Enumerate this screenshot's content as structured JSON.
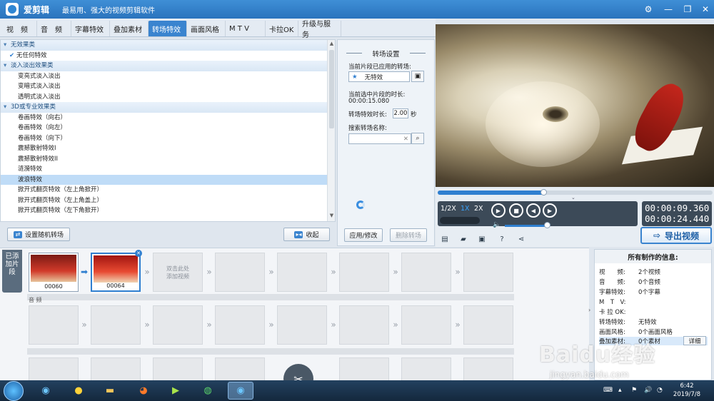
{
  "app": {
    "name": "爱剪辑",
    "slogan": "最易用、强大的视频剪辑软件",
    "window_controls": [
      "⚙",
      "—",
      "❐",
      "✕"
    ]
  },
  "tabs": [
    {
      "label": "视　频",
      "active": false
    },
    {
      "label": "音　频",
      "active": false
    },
    {
      "label": "字幕特效",
      "active": false
    },
    {
      "label": "叠加素材",
      "active": false
    },
    {
      "label": "转场特效",
      "active": true
    },
    {
      "label": "画面风格",
      "active": false
    },
    {
      "label": "M T V",
      "active": false
    },
    {
      "label": "卡拉OK",
      "active": false
    },
    {
      "label": "升级与服务",
      "active": false
    }
  ],
  "effects": {
    "rows": [
      {
        "type": "cat",
        "label": "无效果类"
      },
      {
        "type": "item",
        "label": "无任何特效",
        "checked": true
      },
      {
        "type": "cat",
        "label": "淡入淡出效果类"
      },
      {
        "type": "item",
        "label": "变亮式淡入淡出"
      },
      {
        "type": "item",
        "label": "变暗式淡入淡出"
      },
      {
        "type": "item",
        "label": "透明式淡入淡出"
      },
      {
        "type": "cat",
        "label": "3D或专业效果类"
      },
      {
        "type": "item",
        "label": "卷画特效（向右）"
      },
      {
        "type": "item",
        "label": "卷画特效（向左）"
      },
      {
        "type": "item",
        "label": "卷画特效（向下）"
      },
      {
        "type": "item",
        "label": "震撼散射特效I"
      },
      {
        "type": "item",
        "label": "震撼散射特效II"
      },
      {
        "type": "item",
        "label": "涟漪特效"
      },
      {
        "type": "item",
        "label": "波浪特效",
        "selected": true
      },
      {
        "type": "item",
        "label": "掀开式翻页特效（左上角掀开）"
      },
      {
        "type": "item",
        "label": "掀开式翻页特效（左上角盖上）"
      },
      {
        "type": "item",
        "label": "掀开式翻页特效（左下角掀开）"
      }
    ],
    "random_button": "设置随机转场",
    "favorite_button": "收起"
  },
  "settings": {
    "title": "转场设置",
    "applied_label": "当前片段已应用的转场:",
    "applied_value": "无特效",
    "duration_label": "当前选中片段的时长:",
    "duration_value": "00:00:15.080",
    "effect_duration_label": "转场特效时长:",
    "effect_duration_value": "2.00",
    "effect_duration_unit": "秒",
    "search_label": "搜索转场名称:",
    "search_value": "",
    "apply_button": "应用/修改",
    "delete_button": "删除转场"
  },
  "player": {
    "speeds": [
      "1/2X",
      "1X",
      "2X"
    ],
    "active_speed": "1X",
    "current_time": "00:00:09.360",
    "total_time": "00:00:24.440",
    "progress": 0.384,
    "volume": 0.9,
    "export_button": "导出视频"
  },
  "timeline": {
    "side_label": "已添加片段",
    "clips": [
      {
        "label": "00060"
      },
      {
        "label": "00064",
        "selected": true
      }
    ],
    "add_hint": "双击此处\n添加视频",
    "audio_label": "音 频"
  },
  "info": {
    "title": "所有制作的信息:",
    "rows": [
      {
        "k": "视　　频:",
        "v": "2个视频"
      },
      {
        "k": "音　　频:",
        "v": "0个音频"
      },
      {
        "k": "字幕特效:",
        "v": "0个字幕"
      },
      {
        "k": "M　T　V:",
        "v": ""
      },
      {
        "k": "卡 拉 OK:",
        "v": ""
      },
      {
        "k": "转场特效:",
        "v": "无特效"
      },
      {
        "k": "画面风格:",
        "v": "0个画面风格"
      },
      {
        "k": "叠加素材:",
        "v": "0个素材",
        "highlight": true
      }
    ],
    "detail_button": "详细"
  },
  "taskbar": {
    "time": "6:42",
    "date": "2019/7/8"
  },
  "watermark": {
    "brand": "Baidu经验",
    "url": "jingyan.baidu.com"
  }
}
